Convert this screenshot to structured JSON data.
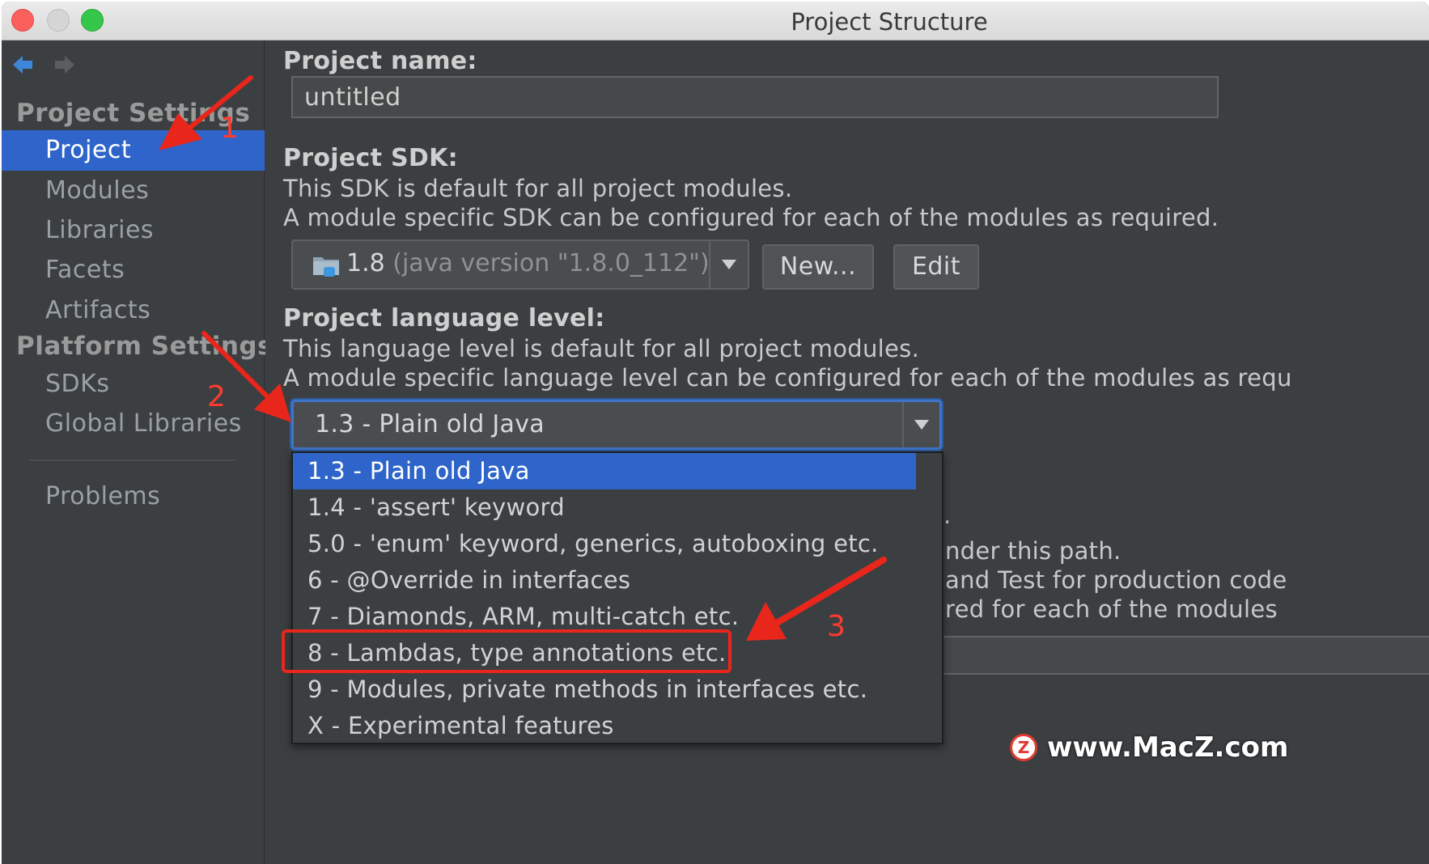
{
  "window": {
    "title": "Project Structure"
  },
  "sidebar": {
    "project_settings_title": "Project Settings",
    "platform_settings_title": "Platform Settings",
    "items": {
      "project": "Project",
      "modules": "Modules",
      "libraries": "Libraries",
      "facets": "Facets",
      "artifacts": "Artifacts",
      "sdks": "SDKs",
      "global_libraries": "Global Libraries",
      "problems": "Problems"
    }
  },
  "main": {
    "project_name_label": "Project name:",
    "project_name_value": "untitled",
    "sdk_label": "Project SDK:",
    "sdk_desc_1": "This SDK is default for all project modules.",
    "sdk_desc_2": "A module specific SDK can be configured for each of the modules as required.",
    "sdk_version": "1.8",
    "sdk_detail": "(java version \"1.8.0_112\")",
    "new_button": "New...",
    "edit_button": "Edit",
    "lang_label": "Project language level:",
    "lang_desc_1": "This language level is default for all project modules.",
    "lang_desc_2": "A module specific language level can be configured for each of the modules as requ",
    "lang_selected": "1.3 - Plain old Java",
    "behind": {
      "line_a": ".",
      "line_b": "nder this path.",
      "line_c": "and Test for production code",
      "line_d": "red for each of the modules"
    },
    "lang_options": [
      "1.3 - Plain old Java",
      "1.4 - 'assert' keyword",
      "5.0 - 'enum' keyword, generics, autoboxing etc.",
      "6 - @Override in interfaces",
      "7 - Diamonds, ARM, multi-catch etc.",
      "8 - Lambdas, type annotations etc.",
      "9 - Modules, private methods in interfaces etc.",
      "X - Experimental features"
    ]
  },
  "annotations": {
    "n1": "1",
    "n2": "2",
    "n3": "3"
  },
  "watermark": {
    "text": "www.MacZ.com",
    "logo": "Z"
  },
  "colors": {
    "accent": "#2f65ca",
    "annotation": "#e8261c",
    "background": "#3c3f41"
  }
}
